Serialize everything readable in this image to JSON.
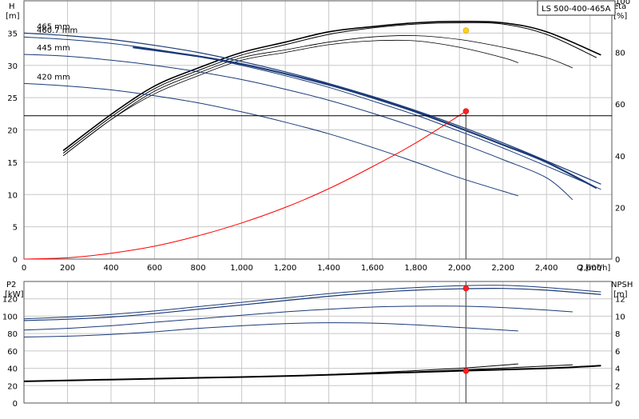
{
  "title_box": "LS 500-400-465A",
  "chart_data": [
    {
      "type": "line",
      "name": "head-chart",
      "ylabel_left": "H",
      "ylabel_left_unit": "[m]",
      "ylabel_right": "eta",
      "ylabel_right_unit": "[%]",
      "xlabel": "Q [m³/h]",
      "xlim": [
        0,
        2700
      ],
      "ylim_left": [
        0,
        40
      ],
      "ylim_right": [
        0,
        100
      ],
      "x_ticks": [
        0,
        200,
        400,
        600,
        800,
        1000,
        1200,
        1400,
        1600,
        1800,
        2000,
        2200,
        2400,
        2600
      ],
      "x_tick_labels": [
        "0",
        "200",
        "400",
        "600",
        "800",
        "1,000",
        "1,200",
        "1,400",
        "1,600",
        "1,800",
        "2,000",
        "2,200",
        "2,400",
        "2,600"
      ],
      "y_ticks_left": [
        0,
        5,
        10,
        15,
        20,
        25,
        30,
        35
      ],
      "y_ticks_right": [
        0,
        20,
        40,
        60,
        80,
        100
      ],
      "grid": true,
      "head_curves": [
        {
          "label": "465 mm",
          "color": "#1a3a78",
          "width": 1.2,
          "x": [
            0,
            200,
            400,
            600,
            800,
            1000,
            1200,
            1400,
            1600,
            1800,
            2000,
            2200,
            2400,
            2650
          ],
          "y": [
            35.0,
            34.6,
            34.0,
            33.1,
            32.0,
            30.6,
            29.0,
            27.2,
            25.2,
            23.0,
            20.6,
            18.0,
            15.2,
            11.6
          ]
        },
        {
          "label": "",
          "color": "#1a3a78",
          "width": 2.2,
          "x": [
            500,
            800,
            1000,
            1200,
            1400,
            1600,
            1800,
            2000,
            2200,
            2400,
            2630
          ],
          "y": [
            32.8,
            31.4,
            30.2,
            28.7,
            27.0,
            25.0,
            22.8,
            20.3,
            17.7,
            15.0,
            11.0
          ]
        },
        {
          "label": "460.7 mm",
          "color": "#1a3a78",
          "width": 1.0,
          "x": [
            0,
            200,
            400,
            600,
            800,
            1000,
            1200,
            1400,
            1600,
            1800,
            2000,
            2200,
            2400,
            2650
          ],
          "y": [
            34.4,
            34.0,
            33.4,
            32.5,
            31.4,
            30.0,
            28.4,
            26.6,
            24.5,
            22.3,
            19.8,
            17.2,
            14.4,
            10.8
          ]
        },
        {
          "label": "445 mm",
          "color": "#1a3a78",
          "width": 1.0,
          "x": [
            0,
            200,
            400,
            600,
            800,
            1000,
            1200,
            1400,
            1600,
            1800,
            2000,
            2200,
            2400,
            2520
          ],
          "y": [
            31.7,
            31.4,
            30.8,
            30.0,
            29.0,
            27.8,
            26.3,
            24.6,
            22.6,
            20.4,
            18.0,
            15.4,
            12.6,
            9.2
          ]
        },
        {
          "label": "420 mm",
          "color": "#1a3a78",
          "width": 1.0,
          "x": [
            0,
            200,
            400,
            600,
            800,
            1000,
            1200,
            1400,
            1600,
            1800,
            2000,
            2270
          ],
          "y": [
            27.2,
            26.8,
            26.2,
            25.3,
            24.2,
            22.8,
            21.2,
            19.4,
            17.3,
            15.0,
            12.6,
            9.8
          ]
        }
      ],
      "eta_curves": [
        {
          "color": "#000000",
          "width": 1.6,
          "x": [
            180,
            400,
            600,
            800,
            1000,
            1200,
            1400,
            1600,
            1800,
            2000,
            2200,
            2400,
            2650
          ],
          "eta": [
            42,
            56,
            67,
            74,
            80,
            84,
            88,
            90,
            91.5,
            92,
            91.5,
            88,
            79
          ]
        },
        {
          "color": "#000000",
          "width": 1.0,
          "x": [
            180,
            400,
            600,
            800,
            1000,
            1200,
            1400,
            1600,
            1800,
            2000,
            2200,
            2400,
            2630
          ],
          "eta": [
            41,
            55,
            66,
            73,
            79,
            83,
            87,
            89.5,
            91,
            91.5,
            91,
            87,
            78
          ]
        },
        {
          "color": "#000000",
          "width": 0.8,
          "x": [
            180,
            400,
            600,
            800,
            1000,
            1200,
            1400,
            1600,
            1800,
            2000,
            2200,
            2400,
            2520
          ],
          "eta": [
            40,
            54,
            65,
            72,
            78,
            81,
            84,
            86,
            86.5,
            85,
            82,
            78,
            74
          ]
        },
        {
          "color": "#000000",
          "width": 0.8,
          "x": [
            180,
            400,
            600,
            800,
            1000,
            1200,
            1400,
            1600,
            1800,
            2000,
            2200,
            2270
          ],
          "eta": [
            40,
            54,
            64,
            71,
            77,
            80,
            83,
            84.5,
            84.5,
            82,
            78,
            76
          ]
        }
      ],
      "system_curve": {
        "color": "#ff0000",
        "x": [
          0,
          200,
          400,
          600,
          800,
          1000,
          1200,
          1400,
          1600,
          1800,
          2030
        ],
        "y": [
          0,
          0.2,
          0.9,
          2.0,
          3.6,
          5.6,
          8.0,
          10.9,
          14.3,
          18.0,
          22.9
        ]
      },
      "duty_point": {
        "q": 2030,
        "h": 22.9,
        "eta": 88.5,
        "h_line": 22.2
      }
    },
    {
      "type": "line",
      "name": "power-npsh-chart",
      "ylabel_left": "P2",
      "ylabel_left_unit": "[kW]",
      "ylabel_right": "NPSH",
      "ylabel_right_unit": "[m]",
      "ylim_left": [
        0,
        140
      ],
      "ylim_right": [
        0,
        14
      ],
      "y_ticks_left": [
        0,
        20,
        40,
        60,
        80,
        100,
        120
      ],
      "y_ticks_right": [
        0,
        2,
        4,
        6,
        8,
        10,
        12
      ],
      "power_curves": [
        {
          "color": "#1a3a78",
          "width": 1.2,
          "x": [
            0,
            200,
            400,
            600,
            800,
            1000,
            1200,
            1400,
            1600,
            1800,
            2000,
            2200,
            2400,
            2650
          ],
          "y": [
            95,
            96.5,
            99,
            103,
            108,
            113,
            118,
            123,
            127,
            130,
            131.5,
            132,
            130,
            125
          ]
        },
        {
          "color": "#1a3a78",
          "width": 1.0,
          "x": [
            0,
            200,
            400,
            600,
            800,
            1000,
            1200,
            1400,
            1600,
            1800,
            2000,
            2200,
            2400,
            2650
          ],
          "y": [
            97,
            99,
            102,
            106,
            111,
            116,
            121,
            126,
            130,
            133,
            135,
            135.5,
            133,
            128
          ]
        },
        {
          "color": "#1a3a78",
          "width": 1.0,
          "x": [
            0,
            200,
            400,
            600,
            800,
            1000,
            1200,
            1400,
            1600,
            1800,
            2000,
            2200,
            2400,
            2520
          ],
          "y": [
            84,
            86,
            89,
            93,
            97,
            101,
            105,
            108,
            110.5,
            111.5,
            111.5,
            110,
            107,
            105
          ]
        },
        {
          "color": "#1a3a78",
          "width": 1.0,
          "x": [
            0,
            200,
            400,
            600,
            800,
            1000,
            1200,
            1400,
            1600,
            1800,
            2000,
            2270
          ],
          "y": [
            76,
            77,
            79,
            82,
            86,
            89,
            91.5,
            92.5,
            92,
            90,
            87,
            83
          ]
        }
      ],
      "npsh_curves": [
        {
          "color": "#000000",
          "width": 2.0,
          "x": [
            0,
            400,
            800,
            1200,
            1600,
            2000,
            2400,
            2650
          ],
          "npsh": [
            2.5,
            2.7,
            2.9,
            3.1,
            3.4,
            3.7,
            4.0,
            4.3
          ]
        },
        {
          "color": "#000000",
          "width": 1.0,
          "x": [
            0,
            400,
            800,
            1200,
            1600,
            2000,
            2270
          ],
          "npsh": [
            2.5,
            2.7,
            2.9,
            3.1,
            3.5,
            4.0,
            4.5
          ]
        },
        {
          "color": "#000000",
          "width": 1.0,
          "x": [
            0,
            400,
            800,
            1200,
            1600,
            2000,
            2520
          ],
          "npsh": [
            2.5,
            2.7,
            2.9,
            3.1,
            3.4,
            3.8,
            4.4
          ]
        }
      ],
      "duty_power": 132,
      "duty_npsh": 3.7
    }
  ]
}
